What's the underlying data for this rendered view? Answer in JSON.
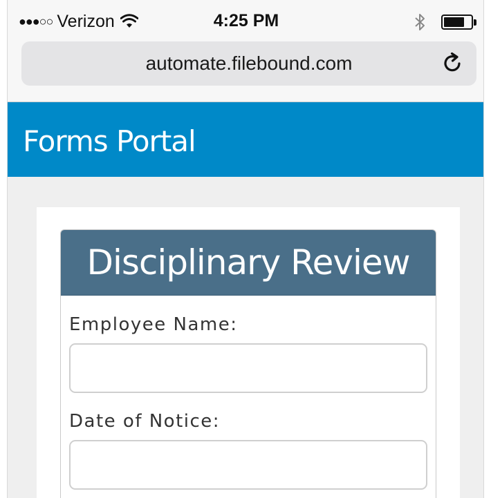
{
  "status_bar": {
    "signal": "●●●○○",
    "carrier": "Verizon",
    "time": "4:25 PM",
    "battery_level": 0.7
  },
  "browser": {
    "url": "automate.filebound.com"
  },
  "header": {
    "title": "Forms Portal"
  },
  "form": {
    "title": "Disciplinary Review",
    "fields": [
      {
        "label": "Employee Name:",
        "value": "",
        "placeholder": ""
      },
      {
        "label": "Date of Notice:",
        "value": "",
        "placeholder": ""
      }
    ]
  },
  "colors": {
    "header_bg": "#0089c8",
    "form_header_bg": "#4a6f89",
    "page_bg": "#efefef"
  }
}
